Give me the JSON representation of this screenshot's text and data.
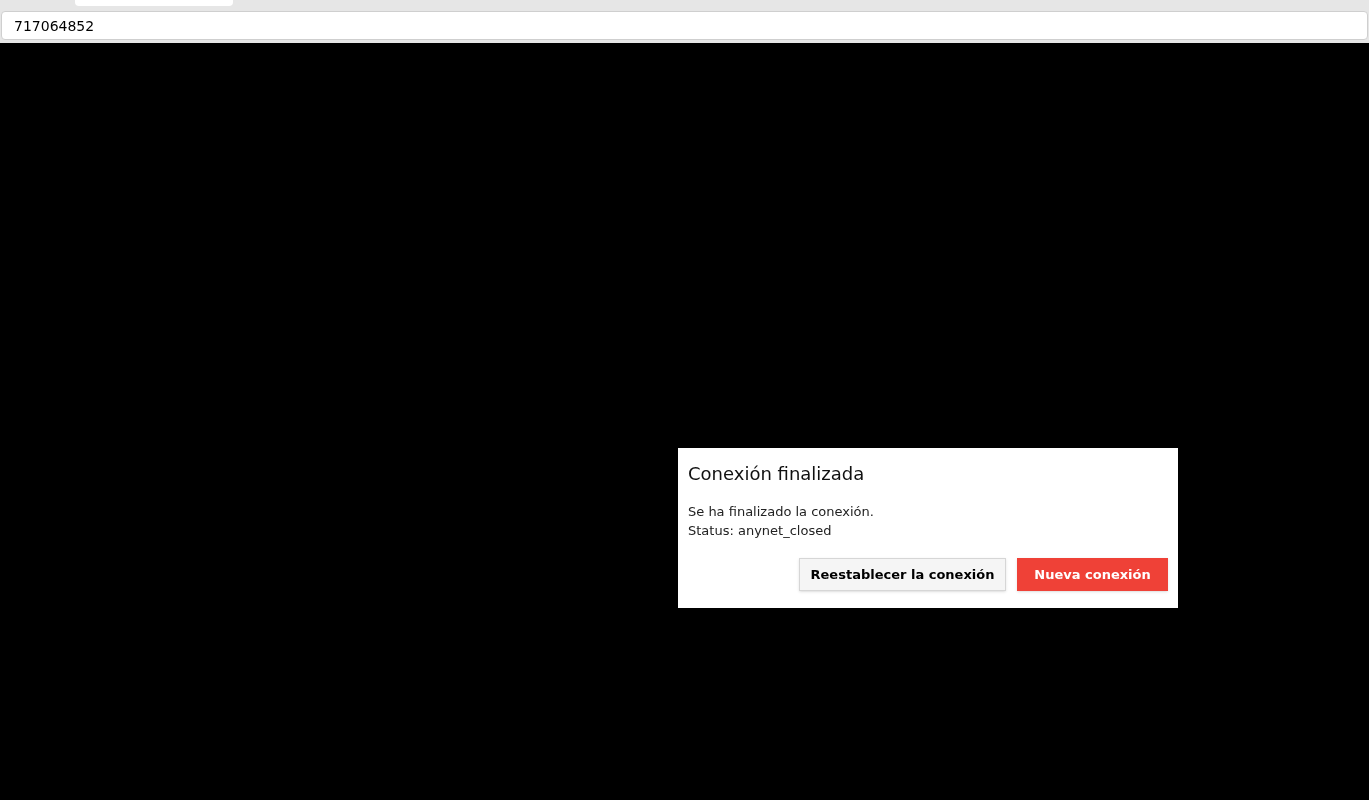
{
  "address_bar": {
    "value": "717064852"
  },
  "dialog": {
    "title": "Conexión finalizada",
    "lines": [
      "Se ha finalizado la conexión.",
      "Status: anynet_closed"
    ],
    "buttons": [
      {
        "label": "Reestablecer la conexión",
        "kind": "secondary"
      },
      {
        "label": "Nueva conexión",
        "kind": "primary"
      }
    ]
  }
}
